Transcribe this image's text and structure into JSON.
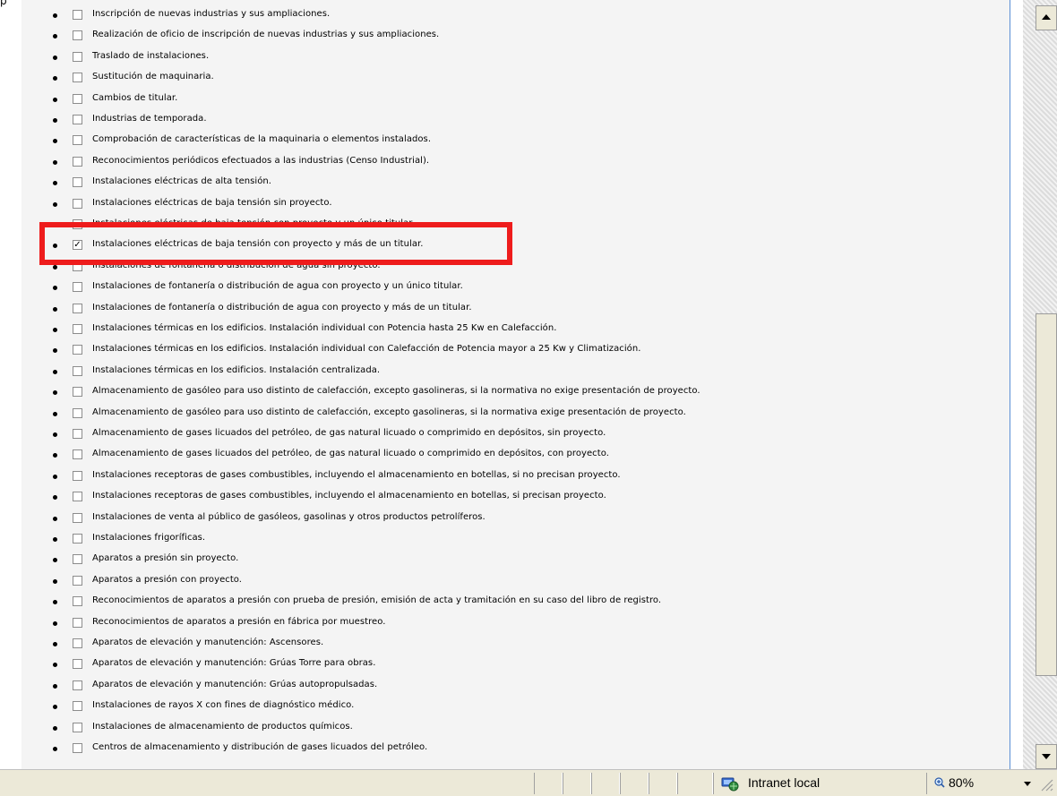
{
  "page_fragment": "p",
  "options": [
    {
      "label": "Inscripción de nuevas industrias y sus ampliaciones.",
      "checked": false
    },
    {
      "label": "Realización de oficio de inscripción de nuevas industrias y sus ampliaciones.",
      "checked": false
    },
    {
      "label": "Traslado de instalaciones.",
      "checked": false
    },
    {
      "label": "Sustitución de maquinaria.",
      "checked": false
    },
    {
      "label": "Cambios de titular.",
      "checked": false
    },
    {
      "label": "Industrias de temporada.",
      "checked": false
    },
    {
      "label": "Comprobación de características de la maquinaria o elementos instalados.",
      "checked": false
    },
    {
      "label": "Reconocimientos periódicos efectuados a las industrias (Censo Industrial).",
      "checked": false
    },
    {
      "label": "Instalaciones eléctricas de alta tensión.",
      "checked": false
    },
    {
      "label": "Instalaciones eléctricas de baja tensión sin proyecto.",
      "checked": false
    },
    {
      "label": "Instalaciones eléctricas de baja tensión con proyecto y un único titular.",
      "checked": false
    },
    {
      "label": "Instalaciones eléctricas de baja tensión con proyecto y más de un titular.",
      "checked": true
    },
    {
      "label": "Instalaciones de fontanería o distribución de agua sin proyecto.",
      "checked": false
    },
    {
      "label": "Instalaciones de fontanería o distribución de agua con proyecto y un único titular.",
      "checked": false
    },
    {
      "label": "Instalaciones de fontanería o distribución de agua con proyecto y más de un titular.",
      "checked": false
    },
    {
      "label": "Instalaciones térmicas en los edificios. Instalación individual con Potencia hasta 25 Kw en Calefacción.",
      "checked": false
    },
    {
      "label": "Instalaciones térmicas en los edificios. Instalación individual con Calefacción de Potencia mayor a 25 Kw y Climatización.",
      "checked": false
    },
    {
      "label": "Instalaciones térmicas en los edificios. Instalación centralizada.",
      "checked": false
    },
    {
      "label": "Almacenamiento de gasóleo para uso distinto de calefacción, excepto gasolineras, si la normativa no exige presentación de proyecto.",
      "checked": false
    },
    {
      "label": "Almacenamiento de gasóleo para uso distinto de calefacción, excepto gasolineras, si la normativa exige presentación de proyecto.",
      "checked": false
    },
    {
      "label": "Almacenamiento de gases licuados del petróleo, de gas natural licuado o comprimido en depósitos, sin proyecto.",
      "checked": false
    },
    {
      "label": "Almacenamiento de gases licuados del petróleo, de gas natural licuado o comprimido en depósitos, con proyecto.",
      "checked": false
    },
    {
      "label": "Instalaciones receptoras de gases combustibles, incluyendo el almacenamiento en botellas, si no precisan proyecto.",
      "checked": false
    },
    {
      "label": "Instalaciones receptoras de gases combustibles, incluyendo el almacenamiento en botellas, si precisan proyecto.",
      "checked": false
    },
    {
      "label": "Instalaciones de venta al público de gasóleos, gasolinas y otros productos petrolíferos.",
      "checked": false
    },
    {
      "label": "Instalaciones frigoríficas.",
      "checked": false
    },
    {
      "label": "Aparatos a presión sin proyecto.",
      "checked": false
    },
    {
      "label": "Aparatos a presión con proyecto.",
      "checked": false
    },
    {
      "label": "Reconocimientos de aparatos a presión con prueba de presión, emisión de acta y tramitación en su caso del libro de registro.",
      "checked": false
    },
    {
      "label": "Reconocimientos de aparatos a presión en fábrica por muestreo.",
      "checked": false
    },
    {
      "label": "Aparatos de elevación y manutención: Ascensores.",
      "checked": false
    },
    {
      "label": "Aparatos de elevación y manutención: Grúas Torre para obras.",
      "checked": false
    },
    {
      "label": "Aparatos de elevación y manutención: Grúas autopropulsadas.",
      "checked": false
    },
    {
      "label": "Instalaciones de rayos X con fines de diagnóstico médico.",
      "checked": false
    },
    {
      "label": "Instalaciones de almacenamiento de productos químicos.",
      "checked": false
    },
    {
      "label": "Centros de almacenamiento y distribución de gases licuados del petróleo.",
      "checked": false
    }
  ],
  "highlight": {
    "color": "#ee1c1c"
  },
  "statusbar": {
    "zone_icon": "intranet-zone-icon",
    "zone_text": "Intranet local",
    "zoom_icon": "zoom-magnifier-icon",
    "zoom_text": "80%"
  },
  "colors": {
    "content_bg": "#f4f4f4",
    "statusbar_bg": "#ece9d8",
    "divider": "#5a8fd6"
  }
}
